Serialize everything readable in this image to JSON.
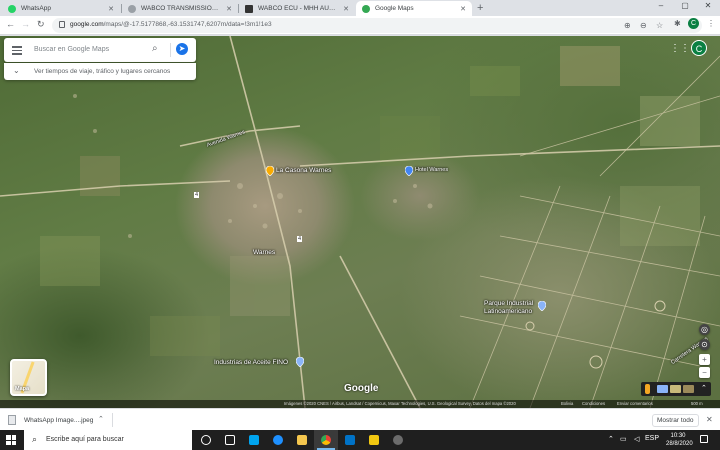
{
  "tabs": [
    {
      "title": "WhatsApp",
      "icon": "whatsapp-icon",
      "color": "#25d366"
    },
    {
      "title": "WABCO TRANSMISSION MODUL",
      "icon": "google-icon",
      "color": "#9aa0a6"
    },
    {
      "title": "WABCO ECU - MHH AUTO - Pag",
      "icon": "mhh-icon",
      "color": "#333333"
    },
    {
      "title": "Google Maps",
      "icon": "maps-pin-icon",
      "color": "#34a853"
    }
  ],
  "toolbar": {
    "url_host": "google.com",
    "url_rest": "/maps/@-17.5177868,-63.1531747,6207m/data=!3m1!1e3",
    "profile_initial": "C"
  },
  "maps": {
    "search_placeholder": "Buscar en Google Maps",
    "travel_text": "Ver tiempos de viaje, tráfico y lugares cercanos",
    "account_initial": "C",
    "layers_label": "Mapa",
    "logo": "Google",
    "places": [
      {
        "name": "La Casona Warnes",
        "kind": "place"
      },
      {
        "name": "Warnes",
        "kind": "town"
      },
      {
        "name": "Parque Industrial Latinoamericano",
        "kind": "place"
      },
      {
        "name": "Industrias de Aceite FINO",
        "kind": "place"
      },
      {
        "name": "Hotel Warnes",
        "kind": "hotel"
      },
      {
        "name": "Avenida Warnes",
        "kind": "road"
      },
      {
        "name": "Carretera Warnes",
        "kind": "road"
      },
      {
        "name": "4",
        "kind": "route"
      },
      {
        "name": "4",
        "kind": "route"
      }
    ],
    "attribution": {
      "imagery": "Imágenes ©2020 CNES / Airbus, Landsat / Copernicus, Maxar Technologies, U.S. Geological Survey, Datos del mapa ©2020",
      "country": "Bolivia",
      "terms": "Condiciones",
      "feedback": "Enviar comentarios",
      "scale": "500 m"
    }
  },
  "download": {
    "file": "WhatsApp Image....jpeg",
    "show_all": "Mostrar todo"
  },
  "taskbar": {
    "search_placeholder": "Escribe aquí para buscar",
    "language": "ESP",
    "time": "10:30",
    "date": "28/8/2020"
  }
}
